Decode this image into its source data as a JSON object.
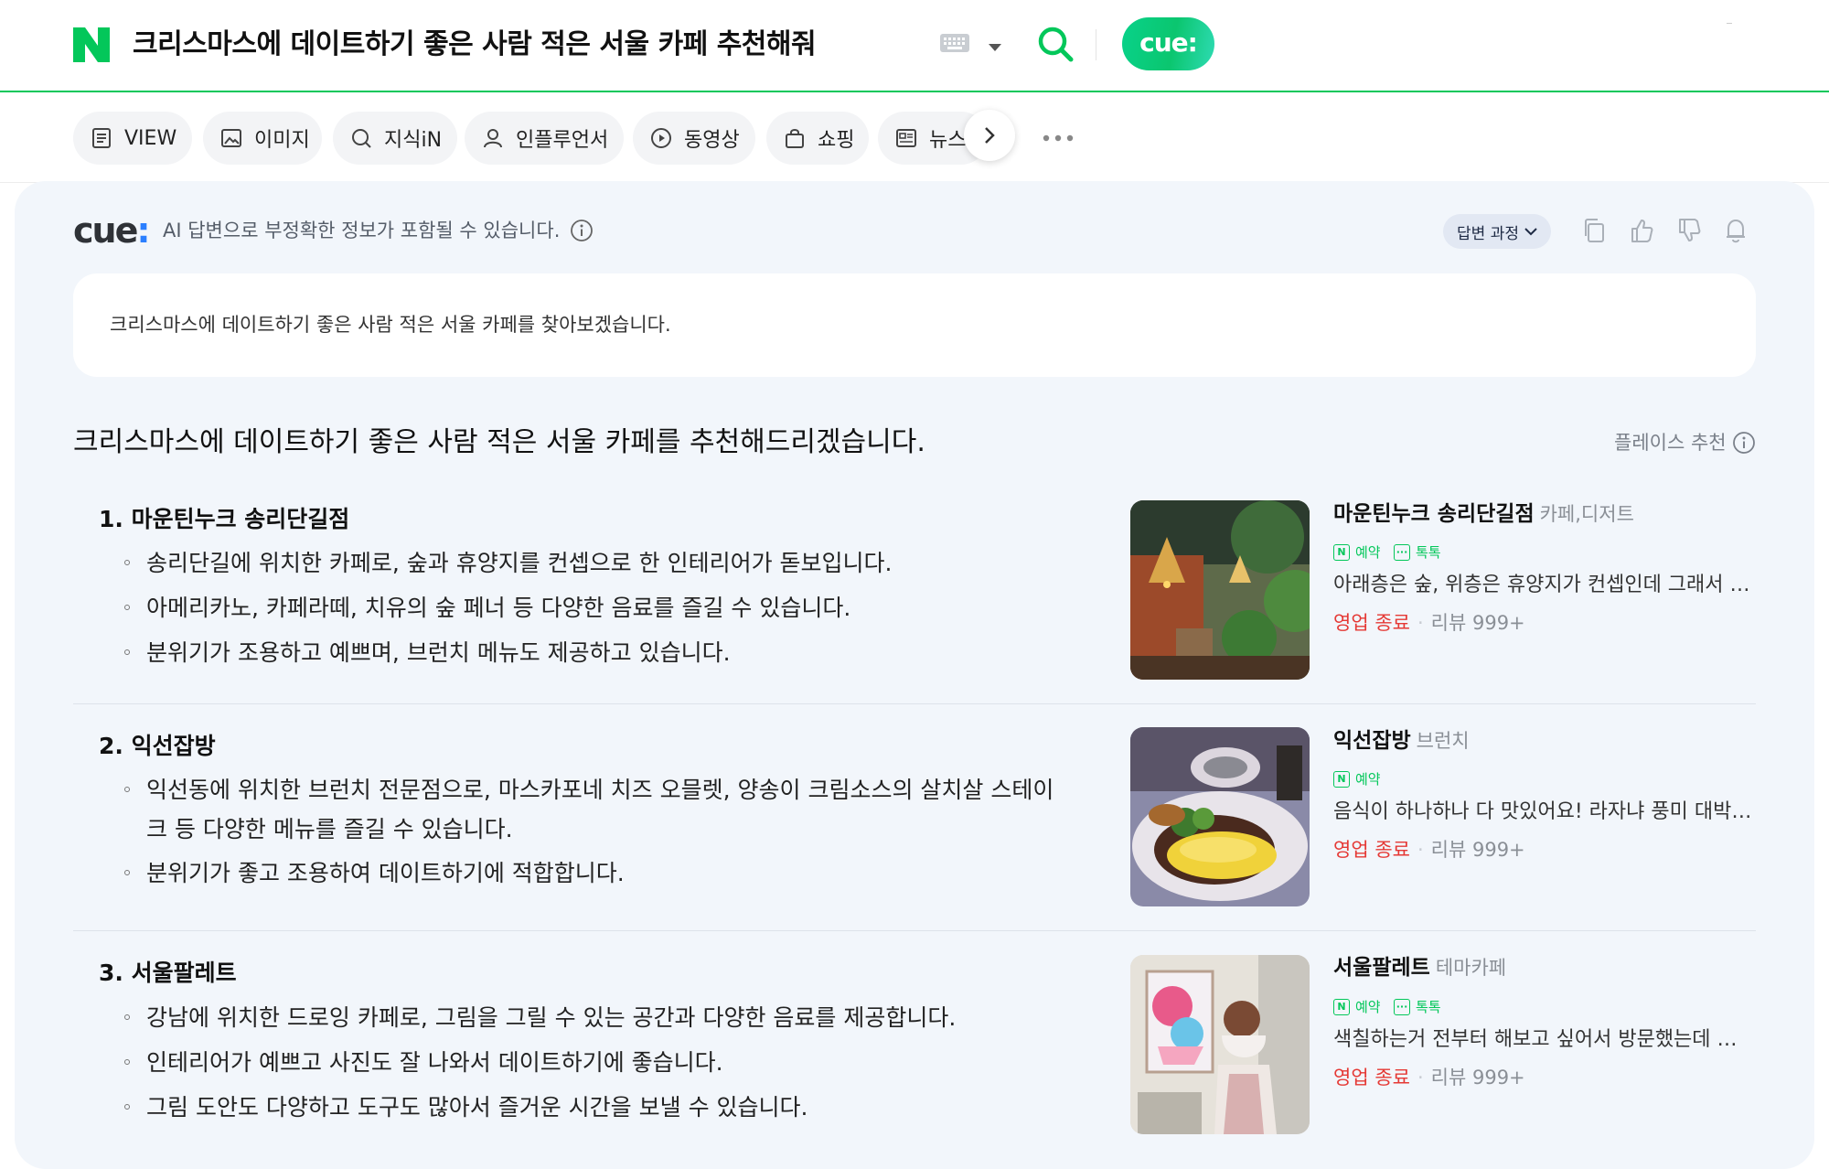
{
  "header": {
    "query": "크리스마스에 데이트하기 좋은 사람 적은 서울 카페 추천해줘",
    "cue_label": "cue:",
    "brand_color": "#03c75a"
  },
  "tabs": [
    {
      "label": "VIEW",
      "icon": "document-icon"
    },
    {
      "label": "이미지",
      "icon": "image-icon"
    },
    {
      "label": "지식iN",
      "icon": "chat-search-icon"
    },
    {
      "label": "인플루언서",
      "icon": "person-icon"
    },
    {
      "label": "동영상",
      "icon": "play-icon"
    },
    {
      "label": "쇼핑",
      "icon": "bag-icon"
    },
    {
      "label": "뉴스",
      "icon": "news-icon"
    }
  ],
  "cue": {
    "logo": "cue",
    "logo_dots": ":",
    "disclaimer": "AI 답변으로 부정확한 정보가 포함될 수 있습니다.",
    "process_label": "답변 과정",
    "summary": "크리스마스에 데이트하기 좋은 사람 적은 서울 카페를 찾아보겠습니다.",
    "headline": "크리스마스에 데이트하기 좋은 사람 적은 서울 카페를 추천해드리겠습니다.",
    "place_recommend": "플레이스 추천"
  },
  "items": [
    {
      "title": "1. 마운틴누크 송리단길점",
      "bullets": [
        "송리단길에 위치한 카페로, 숲과 휴양지를 컨셉으로 한 인테리어가 돋보입니다.",
        "아메리카노, 카페라떼, 치유의 숲 페너 등 다양한 음료를 즐길 수 있습니다.",
        "분위기가 조용하고 예쁘며, 브런치 메뉴도 제공하고 있습니다."
      ],
      "card": {
        "name": "마운틴누크 송리단길점",
        "category": "카페,디저트",
        "badges": [
          "예약",
          "톡톡"
        ],
        "review": "아래층은 숲, 위층은 휴양지가 컨셉인데 그래서 그...",
        "status": "영업 종료",
        "reviews": "리뷰 999+"
      }
    },
    {
      "title": "2. 익선잡방",
      "bullets": [
        "익선동에 위치한 브런치 전문점으로, 마스카포네 치즈 오믈렛, 양송이 크림소스의 살치살 스테이",
        "크 등 다양한 메뉴를 즐길 수 있습니다.",
        "분위기가 좋고 조용하여 데이트하기에 적합합니다."
      ],
      "card": {
        "name": "익선잡방",
        "category": "브런치",
        "badges": [
          "예약"
        ],
        "review": "음식이 하나하나 다 맛있어요! 라자냐 풍미 대박이...",
        "status": "영업 종료",
        "reviews": "리뷰 999+"
      }
    },
    {
      "title": "3. 서울팔레트",
      "bullets": [
        "강남에 위치한 드로잉 카페로, 그림을 그릴 수 있는 공간과 다양한 음료를 제공합니다.",
        "인테리어가 예쁘고 사진도 잘 나와서 데이트하기에 좋습니다.",
        "그림 도안도 다양하고 도구도 많아서 즐거운 시간을 보낼 수 있습니다."
      ],
      "card": {
        "name": "서울팔레트",
        "category": "테마카페",
        "badges": [
          "예약",
          "톡톡"
        ],
        "review": "색칠하는거 전부터 해보고 싶어서 방문했는데 인...",
        "status": "영업 종료",
        "reviews": "리뷰 999+"
      }
    }
  ]
}
